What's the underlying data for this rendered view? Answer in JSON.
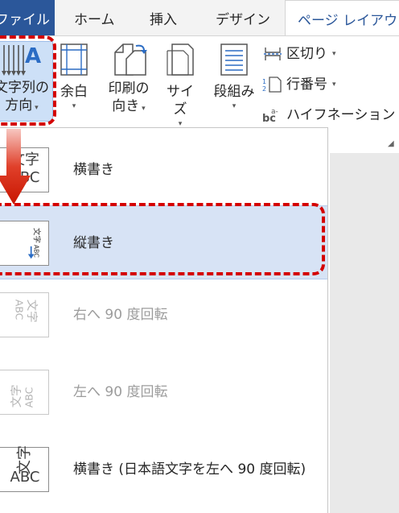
{
  "tabs": {
    "file": "ファイル",
    "home": "ホーム",
    "insert": "挿入",
    "design": "デザイン",
    "page_layout": "ページ レイアウト"
  },
  "ribbon": {
    "text_direction": {
      "line1": "文字列の",
      "line2": "方向",
      "icon": "text-direction-icon"
    },
    "margins": {
      "label": "余白",
      "icon": "margins-icon"
    },
    "orientation": {
      "line1": "印刷の",
      "line2": "向き",
      "icon": "orientation-icon"
    },
    "size": {
      "label": "サイズ",
      "icon": "size-icon"
    },
    "columns": {
      "label": "段組み",
      "icon": "columns-icon"
    },
    "breaks": {
      "label": "区切り",
      "icon": "breaks-icon"
    },
    "line_numbers": {
      "label": "行番号",
      "icon": "line-numbers-icon"
    },
    "hyphenation": {
      "label": "ハイフネーション",
      "icon": "hyphenation-icon"
    }
  },
  "menu": {
    "items": [
      {
        "label": "横書き",
        "icon_text_1": "文字",
        "icon_text_2": "ABC",
        "state": "normal"
      },
      {
        "label": "縦書き",
        "icon_text_1": "文字",
        "icon_text_2": "ABC",
        "state": "selected"
      },
      {
        "label": "右へ 90 度回転",
        "icon_text_1": "文字",
        "icon_text_2": "ABC",
        "state": "disabled"
      },
      {
        "label": "左へ 90 度回転",
        "icon_text_1": "文字",
        "icon_text_2": "ABC",
        "state": "disabled"
      },
      {
        "label": "横書き (日本語文字を左へ 90 度回転)",
        "icon_text_1": "文字",
        "icon_text_2": "ABC",
        "state": "normal"
      }
    ]
  },
  "colors": {
    "file_tab": "#2b579a",
    "selected_item": "#d7e3f5",
    "highlight": "#d40000"
  }
}
